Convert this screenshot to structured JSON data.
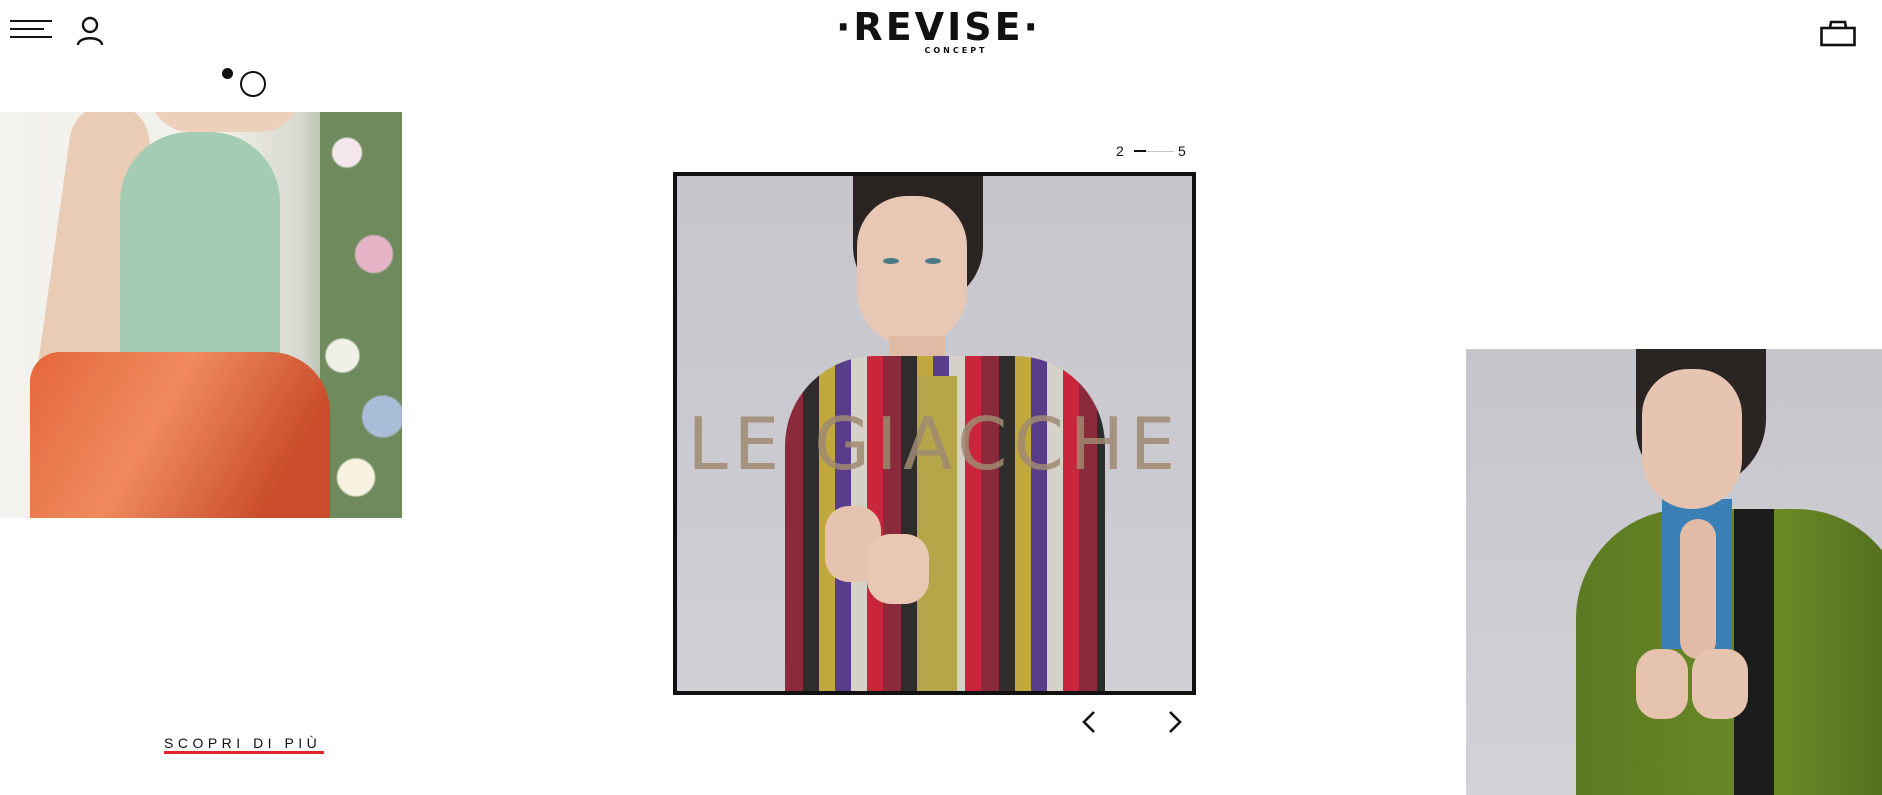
{
  "header": {
    "logo_main": "·REVISE·",
    "logo_sub": "CONCEPT",
    "menu_icon": "hamburger-menu-icon",
    "user_icon": "user-icon",
    "cart_icon": "shopping-bag-icon"
  },
  "left_panel": {
    "cta_label": "SCOPRI DI PIÙ",
    "cta_underline_color": "#e0242f"
  },
  "slider": {
    "current": "2",
    "total": "5",
    "progress": 0.4,
    "slide_title": "LE GIACCHE",
    "prev_icon": "chevron-left-icon",
    "next_icon": "chevron-right-icon"
  },
  "colors": {
    "text": "#111111",
    "accent": "#e0242f",
    "title_overlay": "#a08a72"
  }
}
